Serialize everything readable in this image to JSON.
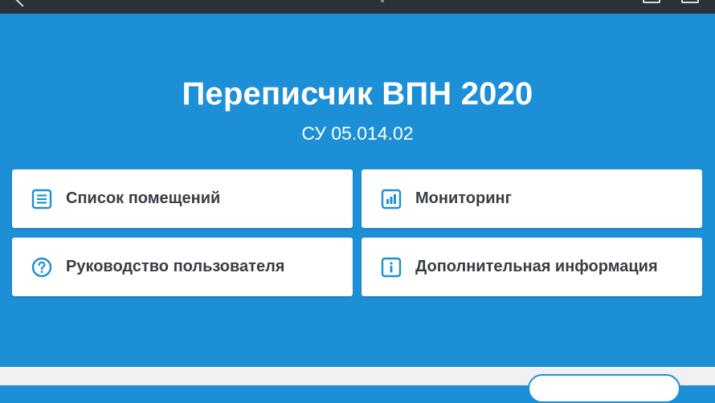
{
  "app": {
    "title": "Переписчик ВПН 2020",
    "subtitle": "СУ 05.014.02"
  },
  "menu": {
    "items": [
      {
        "label": "Список помещений",
        "icon": "list-icon"
      },
      {
        "label": "Мониторинг",
        "icon": "bar-chart-icon"
      },
      {
        "label": "Руководство пользователя",
        "icon": "help-icon"
      },
      {
        "label": "Дополнительная информация",
        "icon": "info-icon"
      }
    ]
  },
  "colors": {
    "accent": "#1d8fd6",
    "topbar": "#2b3139",
    "card_text": "#3a3e44",
    "footer": "#f1f1f1"
  }
}
